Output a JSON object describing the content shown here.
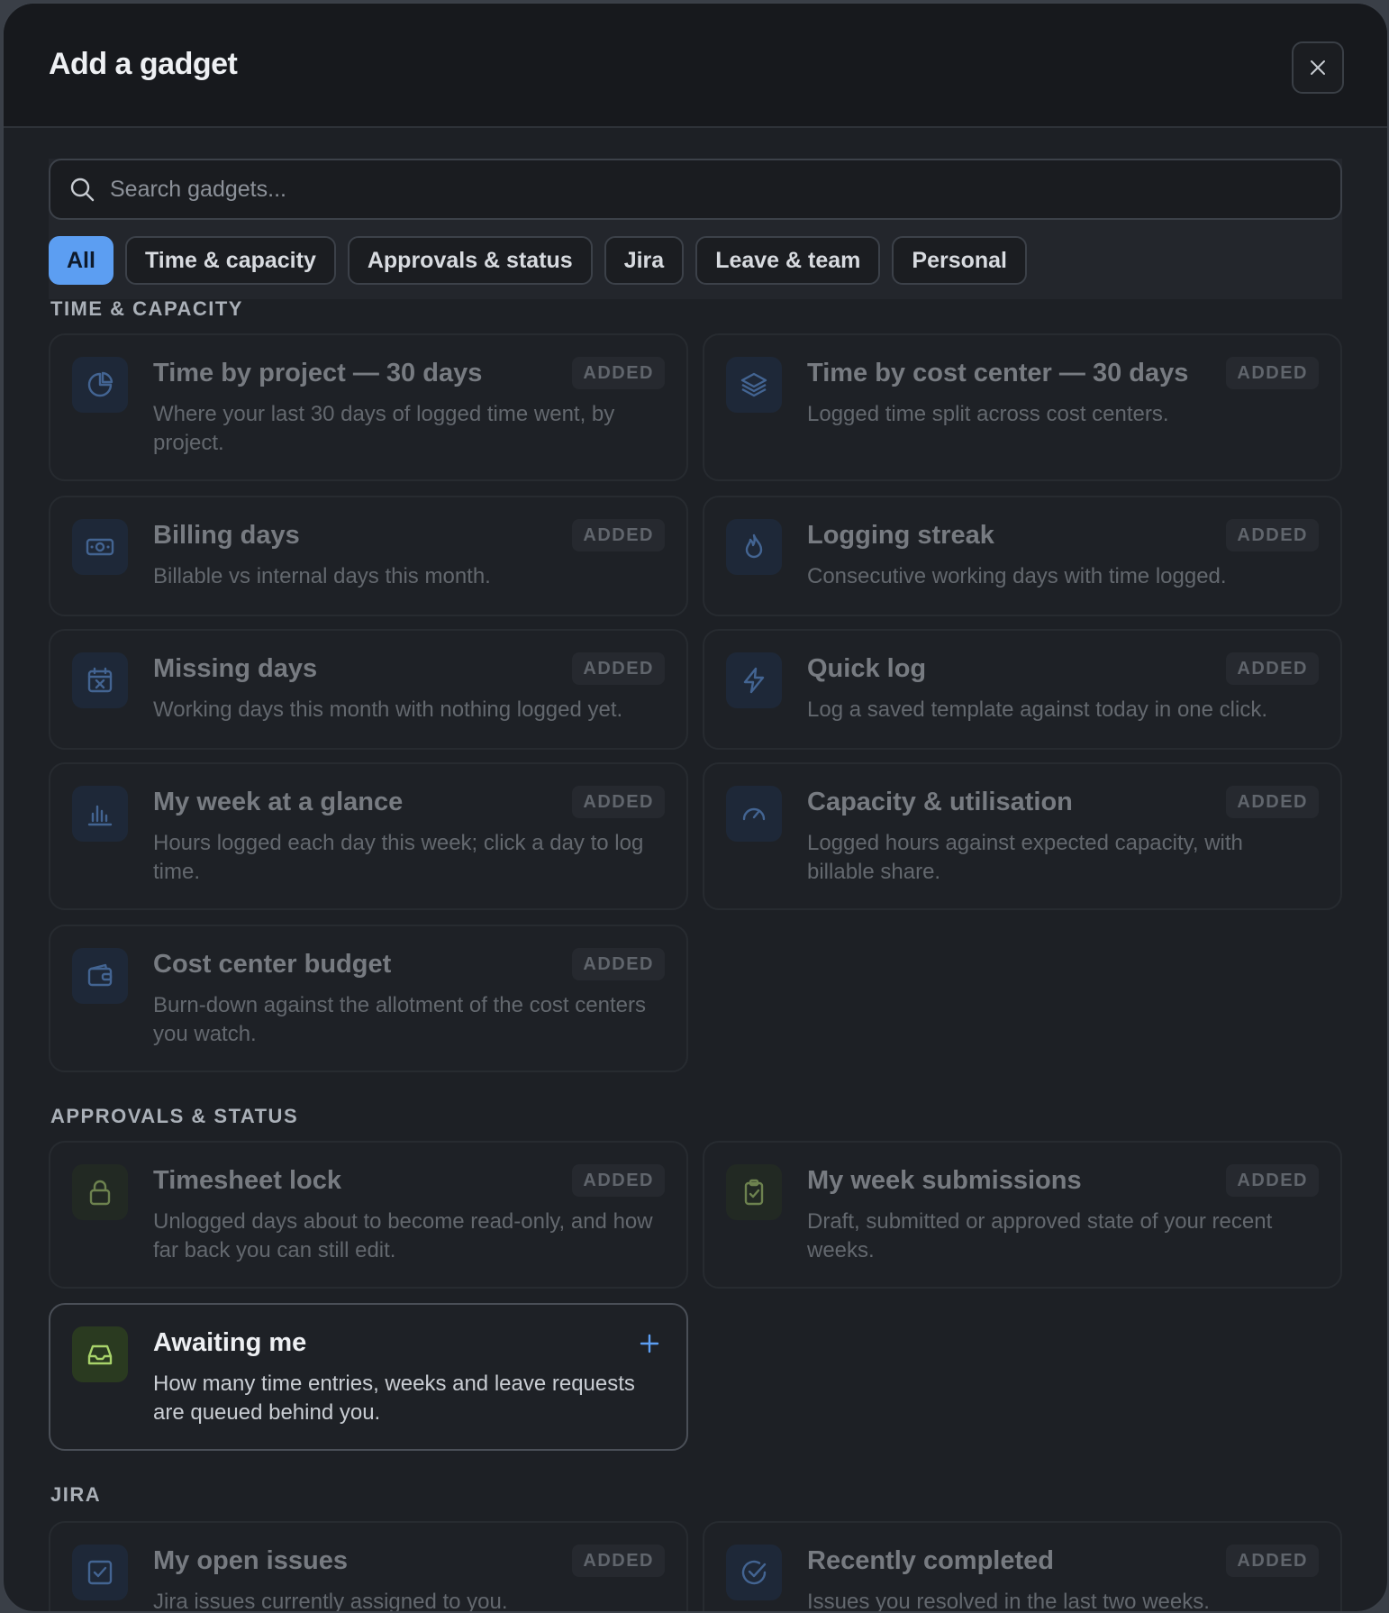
{
  "modal": {
    "title": "Add a gadget"
  },
  "search": {
    "placeholder": "Search gadgets..."
  },
  "filters": [
    "All",
    "Time & capacity",
    "Approvals & status",
    "Jira",
    "Leave & team",
    "Personal"
  ],
  "added_label": "ADDED",
  "sections": {
    "time": {
      "label": "TIME & CAPACITY",
      "cards": [
        {
          "title": "Time by project — 30 days",
          "desc": "Where your last 30 days of logged time went, by project.",
          "icon": "pie-chart-icon"
        },
        {
          "title": "Time by cost center — 30 days",
          "desc": "Logged time split across cost centers.",
          "icon": "layers-icon"
        },
        {
          "title": "Billing days",
          "desc": "Billable vs internal days this month.",
          "icon": "banknote-icon"
        },
        {
          "title": "Logging streak",
          "desc": "Consecutive working days with time logged.",
          "icon": "flame-icon"
        },
        {
          "title": "Missing days",
          "desc": "Working days this month with nothing logged yet.",
          "icon": "calendar-x-icon"
        },
        {
          "title": "Quick log",
          "desc": "Log a saved template against today in one click.",
          "icon": "lightning-icon"
        },
        {
          "title": "My week at a glance",
          "desc": "Hours logged each day this week; click a day to log time.",
          "icon": "bar-chart-icon"
        },
        {
          "title": "Capacity & utilisation",
          "desc": "Logged hours against expected capacity, with billable share.",
          "icon": "gauge-icon"
        },
        {
          "title": "Cost center budget",
          "desc": "Burn-down against the allotment of the cost centers you watch.",
          "icon": "wallet-icon"
        }
      ]
    },
    "approvals": {
      "label": "APPROVALS & STATUS",
      "cards": [
        {
          "title": "Timesheet lock",
          "desc": "Unlogged days about to become read-only, and how far back you can still edit.",
          "icon": "lock-icon"
        },
        {
          "title": "My week submissions",
          "desc": "Draft, submitted or approved state of your recent weeks.",
          "icon": "clipboard-check-icon"
        },
        {
          "title": "Awaiting me",
          "desc": "How many time entries, weeks and leave requests are queued behind you.",
          "icon": "inbox-icon"
        }
      ]
    },
    "jira": {
      "label": "JIRA",
      "cards": [
        {
          "title": "My open issues",
          "desc": "Jira issues currently assigned to you.",
          "icon": "checkbox-icon"
        },
        {
          "title": "Recently completed",
          "desc": "Issues you resolved in the last two weeks.",
          "icon": "check-circle-icon"
        }
      ]
    }
  },
  "colors": {
    "accent": "#5c9ef2",
    "background": "#1d2025",
    "header": "#17191d",
    "icon_blue": "#5b8fd6",
    "icon_green": "#a8d36a"
  }
}
